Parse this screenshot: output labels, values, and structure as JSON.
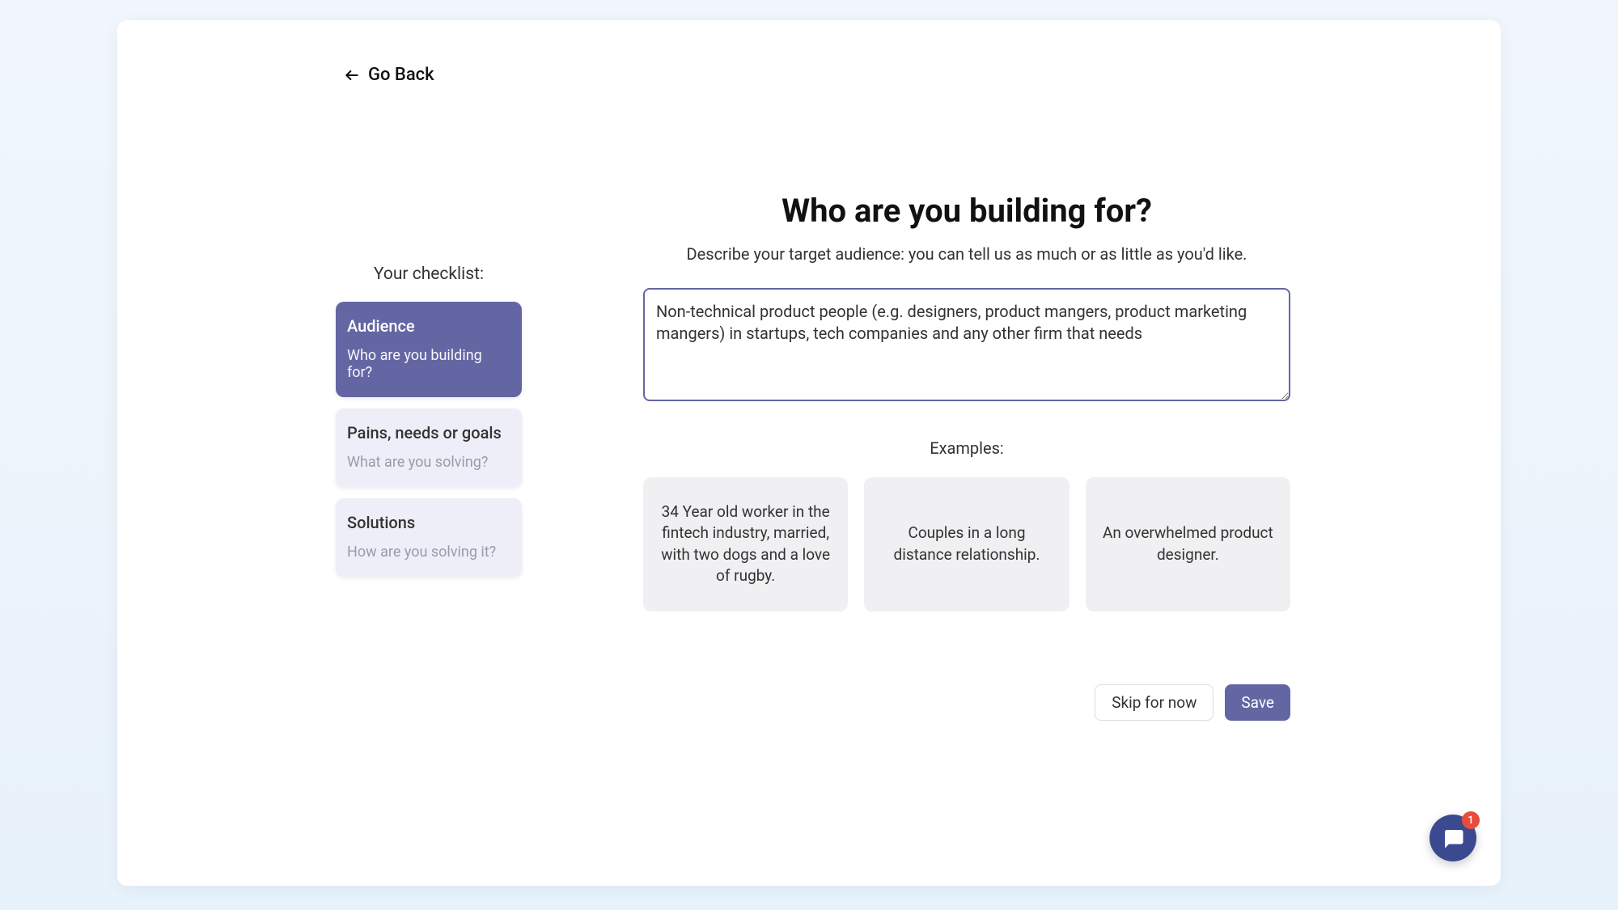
{
  "nav": {
    "go_back_label": "Go Back"
  },
  "sidebar": {
    "title": "Your checklist:",
    "items": [
      {
        "title": "Audience",
        "sub": "Who are you building for?",
        "active": true
      },
      {
        "title": "Pains, needs or goals",
        "sub": "What are you solving?",
        "active": false
      },
      {
        "title": "Solutions",
        "sub": "How are you solving it?",
        "active": false
      }
    ]
  },
  "main": {
    "heading": "Who are you building for?",
    "sub": "Describe your target audience: you can tell us as much or as little as you'd like.",
    "textarea_value": "Non-technical product people (e.g. designers, product mangers, product marketing mangers) in startups, tech companies and any other firm that needs",
    "examples_label": "Examples:",
    "examples": [
      "34 Year old worker in the fintech industry, married, with two dogs and a love of rugby.",
      "Couples in a long distance relationship.",
      "An overwhelmed product designer."
    ],
    "skip_label": "Skip for now",
    "save_label": "Save"
  },
  "chat": {
    "badge_count": "1"
  }
}
